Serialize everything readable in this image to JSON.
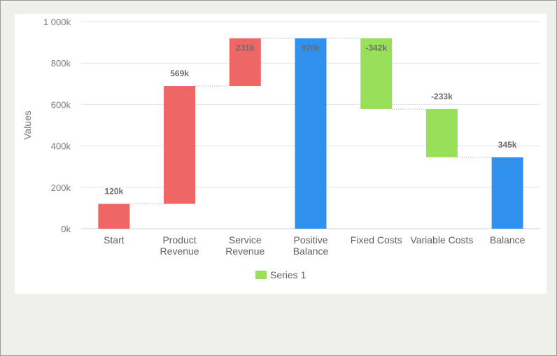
{
  "chart_data": {
    "type": "bar",
    "subtype": "waterfall",
    "ylabel": "Values",
    "ylim": [
      0,
      1000000
    ],
    "yticks": [
      "0k",
      "200k",
      "400k",
      "600k",
      "800k",
      "1 000k"
    ],
    "ytick_values": [
      0,
      200000,
      400000,
      600000,
      800000,
      1000000
    ],
    "grid": true,
    "legend_position": "bottom",
    "categories": [
      [
        "Start"
      ],
      [
        "Product",
        "Revenue"
      ],
      [
        "Service",
        "Revenue"
      ],
      [
        "Positive",
        "Balance"
      ],
      [
        "Fixed Costs"
      ],
      [
        "Variable Costs"
      ],
      [
        "Balance"
      ]
    ],
    "series": [
      {
        "name": "Series 1",
        "values": [
          120000,
          569000,
          231000,
          920000,
          -342000,
          -233000,
          345000
        ],
        "is_sum": [
          false,
          false,
          false,
          true,
          false,
          false,
          true
        ],
        "labels": [
          "120k",
          "569k",
          "231k",
          "920k",
          "-342k",
          "-233k",
          "345k"
        ]
      }
    ],
    "colors": {
      "positive": "#ee6666",
      "negative": "#99e05a",
      "total": "#3191ee",
      "gridline": "#e3e3e3",
      "connector": "#9a9a9a"
    }
  }
}
